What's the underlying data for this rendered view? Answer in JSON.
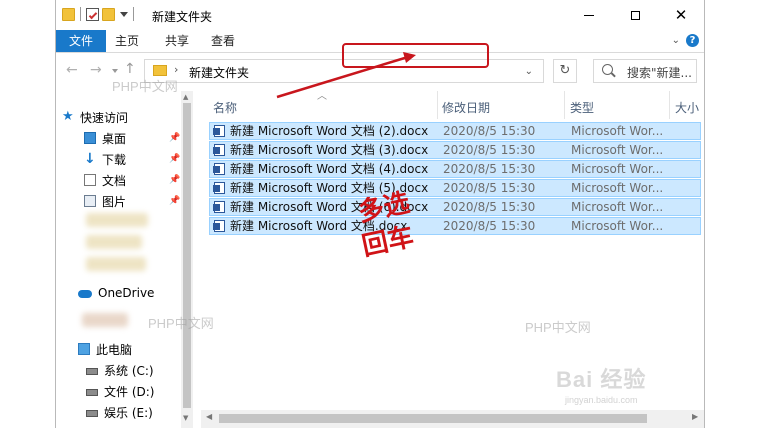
{
  "window": {
    "title": "新建文件夹",
    "qat_folder_icon": "folder-icon",
    "qat_properties_icon": "properties-icon"
  },
  "controls": {
    "minimize_icon": "minimize-icon",
    "maximize_icon": "maximize-icon",
    "close_icon": "close-icon",
    "close_glyph": "✕"
  },
  "ribbon": {
    "tabs": [
      {
        "label": "文件"
      },
      {
        "label": "主页"
      },
      {
        "label": "共享"
      },
      {
        "label": "查看"
      }
    ],
    "expand_glyph": "⌄",
    "help_glyph": "?",
    "file_tab_color": "#1979ca"
  },
  "nav": {
    "back_glyph": "←",
    "forward_glyph": "→",
    "up_glyph": "↑",
    "breadcrumb": "新建文件夹",
    "breadcrumb_separator": "›",
    "refresh_glyph": "↻",
    "address_dropdown_glyph": "⌄",
    "search_placeholder": "搜索\"新建..."
  },
  "navpane": {
    "quick_access": "快速访问",
    "pinned": [
      "桌面",
      "下载",
      "文档",
      "图片"
    ],
    "onedrive": "OneDrive",
    "this_pc": "此电脑",
    "drives": [
      "系统 (C:)",
      "文件 (D:)",
      "娱乐 (E:)"
    ]
  },
  "filelist": {
    "columns": [
      "名称",
      "修改日期",
      "类型",
      "大小"
    ],
    "rows": [
      {
        "name": "新建 Microsoft Word 文档 (2).docx",
        "date": "2020/8/5 15:30",
        "type": "Microsoft Wor..."
      },
      {
        "name": "新建 Microsoft Word 文档 (3).docx",
        "date": "2020/8/5 15:30",
        "type": "Microsoft Wor..."
      },
      {
        "name": "新建 Microsoft Word 文档 (4).docx",
        "date": "2020/8/5 15:30",
        "type": "Microsoft Wor..."
      },
      {
        "name": "新建 Microsoft Word 文档 (5).docx",
        "date": "2020/8/5 15:30",
        "type": "Microsoft Wor..."
      },
      {
        "name": "新建 Microsoft Word 文档 (6).docx",
        "date": "2020/8/5 15:30",
        "type": "Microsoft Wor..."
      },
      {
        "name": "新建 Microsoft Word 文档.docx",
        "date": "2020/8/5 15:30",
        "type": "Microsoft Wor..."
      }
    ],
    "selected_color": "#cce8ff"
  },
  "annotations": {
    "line1": "多选",
    "line2": "回车",
    "color": "#c8161d"
  },
  "watermarks": {
    "site": "PHP中文网",
    "baidu": "Bai 经验",
    "baidu_sub": "jingyan.baidu.com"
  }
}
